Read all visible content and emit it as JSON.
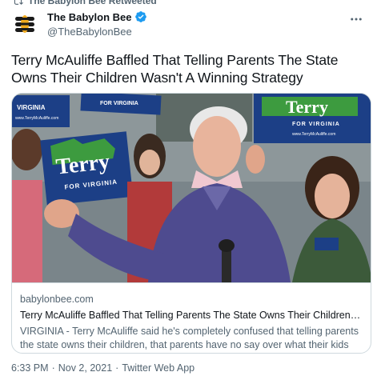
{
  "retweet": {
    "label": "The Babylon Bee Retweeted"
  },
  "author": {
    "display_name": "The Babylon Bee",
    "handle": "@TheBabylonBee",
    "verified": true,
    "brand_color": "#1d9bf0"
  },
  "tweet": {
    "text": "Terry McAuliffe Baffled That Telling Parents The State Owns Their Children Wasn't A Winning Strategy"
  },
  "card": {
    "image_signs": {
      "main_sign": "Terry",
      "main_sign_sub": "FOR VIRGINIA",
      "right_sign": "Terry",
      "right_sign_sub": "FOR VIRGINIA",
      "right_sign_url": "www.TerryMcAuliffe.com",
      "left_sign_top": "VIRGINIA",
      "left_sign_url": "www.TerryMcAuliffe.com",
      "top_sign": "FOR VIRGINIA",
      "sign_color": "#1c3f86",
      "sign_accent": "#3d9b3f"
    },
    "domain": "babylonbee.com",
    "title": "Terry McAuliffe Baffled That Telling Parents The State Owns Their Children Wa...",
    "description": "VIRGINIA - Terry McAuliffe said he's completely confused that telling parents the state owns their children, that parents have no say over what their kids learn in..."
  },
  "meta": {
    "time": "6:33 PM",
    "date": "Nov 2, 2021",
    "source": "Twitter Web App",
    "separator": "·"
  }
}
